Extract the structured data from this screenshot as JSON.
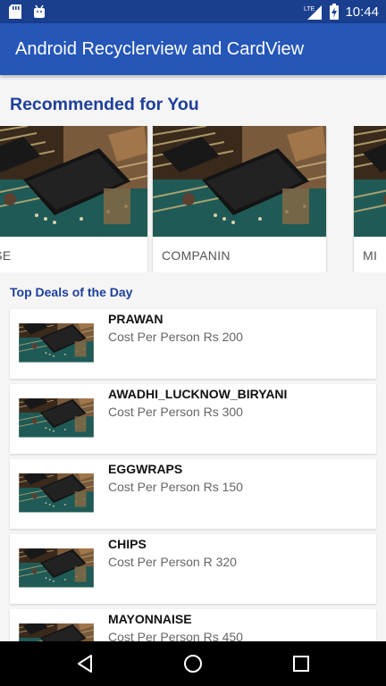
{
  "status_bar": {
    "time": "10:44",
    "network": "LTE",
    "icons": [
      "sd-card-icon",
      "android-icon",
      "signal-icon",
      "battery-charging-icon"
    ]
  },
  "app_bar": {
    "title": "Android Recyclerview and CardView"
  },
  "recommended": {
    "title": "Recommended for You",
    "cards": [
      {
        "label": "NAISE"
      },
      {
        "label": "COMPANIN"
      },
      {
        "label": "MI"
      }
    ]
  },
  "deals": {
    "title": "Top Deals of the Day",
    "items": [
      {
        "name": "PRAWAN",
        "cost": "Cost Per Person Rs 200"
      },
      {
        "name": "AWADHI_LUCKNOW_BIRYANI",
        "cost": "Cost Per Person Rs 300"
      },
      {
        "name": "EGGWRAPS",
        "cost": "Cost Per Person Rs 150"
      },
      {
        "name": "CHIPS",
        "cost": "Cost Per Person R 320"
      },
      {
        "name": "MAYONNAISE",
        "cost": "Cost Per Person Rs 450"
      }
    ]
  },
  "nav": {
    "icons": [
      "back-icon",
      "home-icon",
      "recents-icon"
    ]
  },
  "colors": {
    "status_bar": "#1a3f8f",
    "app_bar": "#2556b8",
    "accent_text": "#1e3f9a",
    "background": "#f5f5f5"
  }
}
